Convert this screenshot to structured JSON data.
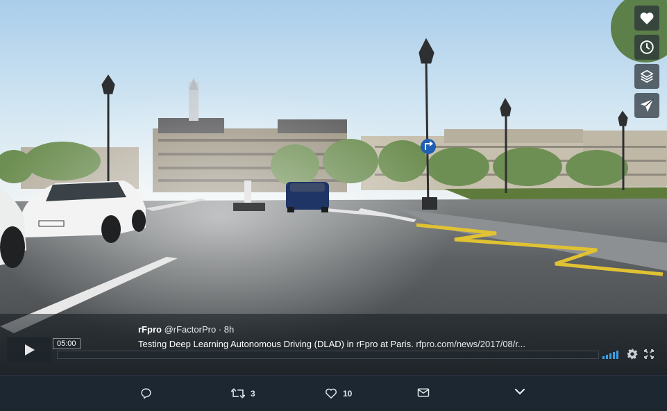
{
  "overlay_actions": [
    {
      "icon": "heart-icon"
    },
    {
      "icon": "clock-icon"
    },
    {
      "icon": "layers-icon"
    },
    {
      "icon": "send-icon"
    }
  ],
  "tweet": {
    "name": "rFpro",
    "handle": "@rFactorPro",
    "separator": "·",
    "time": "8h",
    "text": "Testing Deep Learning Autonomous Driving (DLAD) in rFpro at Paris.",
    "link": "rfpro.com/news/2017/08/r..."
  },
  "player": {
    "timecode": "05:00",
    "progress": 0.0,
    "volume_bars": 5
  },
  "actions": {
    "reply_count": "",
    "retweet_count": "3",
    "like_count": "10"
  },
  "colors": {
    "background": "#1b2733",
    "action_bar": "#1c2731",
    "accent": "#3aa0e8",
    "road_marking": "#e0c232"
  }
}
